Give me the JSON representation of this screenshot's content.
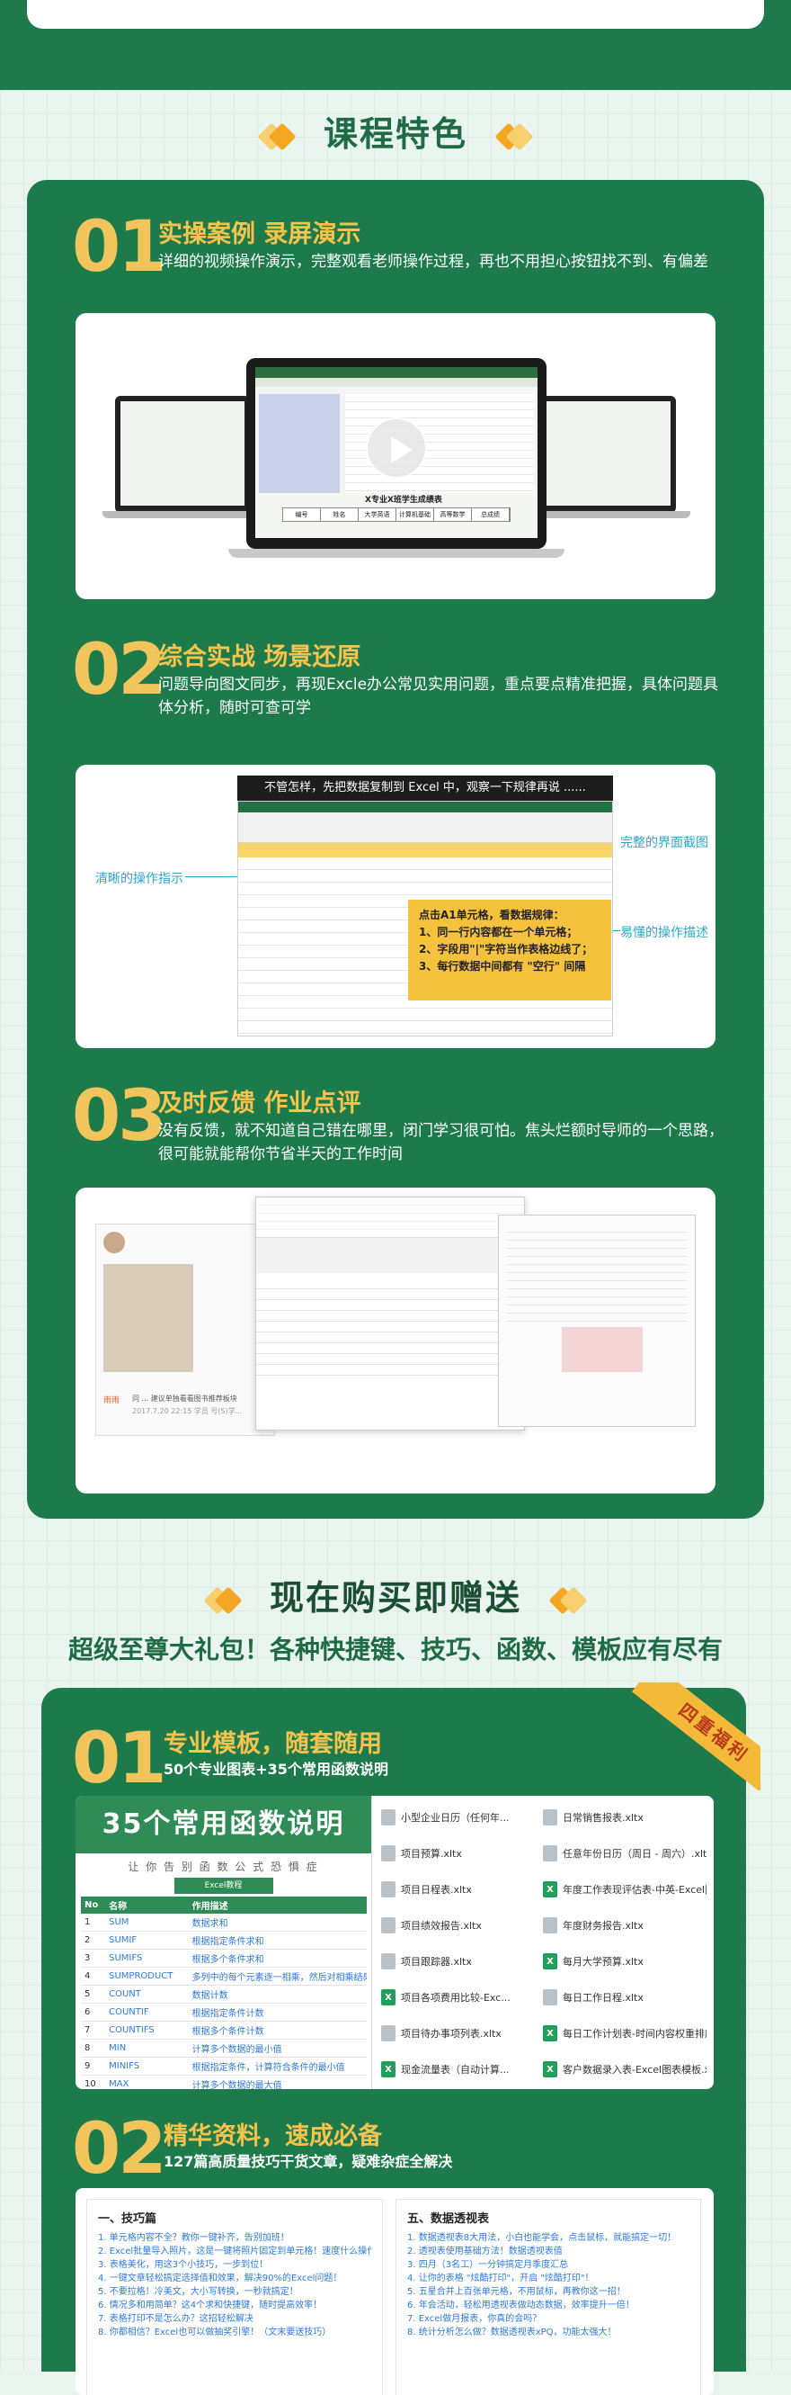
{
  "section_features": {
    "title": "课程特色",
    "items": [
      {
        "num": "01",
        "title": "实操案例  录屏演示",
        "desc": "详细的视频操作演示，完整观看老师操作过程，再也不用担心按钮找不到、有偏差"
      },
      {
        "num": "02",
        "title": "综合实战 场景还原",
        "desc": "问题导向图文同步，再现Excle办公常见实用问题，重点要点精准把握，具体问题具体分析，随时可查可学"
      },
      {
        "num": "03",
        "title": "及时反馈  作业点评",
        "desc": "没有反馈，就不知道自己错在哪里，闭门学习很可怕。焦头烂额时导师的一个思路，很可能就能帮你节省半天的工作时间"
      }
    ],
    "laptop_caption": "X专业X班学生成绩表",
    "laptop_cols": [
      "编号",
      "姓名",
      "大学英语",
      "计算机基础",
      "高等数学",
      "总成绩"
    ],
    "example_header": "不管怎样，先把数据复制到 Excel 中，观察一下规律再说 ......",
    "callout_left": "清晰的操作指示",
    "callout_right_top": "完整的界面截图",
    "callout_right_bottom": "易懂的操作描述",
    "rule_title": "点击A1单元格，看数据规律：",
    "rule_lines": [
      "1、同一行内容都在一个单元格；",
      "2、字段用\"|\"字符当作表格边线了；",
      "3、每行数据中间都有 \"空行\" 间隔"
    ],
    "feedback_name": "雨雨",
    "feedback_note": "问 ... 建议单独看看图书推荐板块",
    "feedback_time": "2017.7.20 22:15 学员 号(S)学..."
  },
  "section_gift": {
    "title": "现在购买即赠送",
    "subtitle": "超级至尊大礼包！各种快捷键、技巧、函数、模板应有尽有",
    "ribbon": "四重福利",
    "items": [
      {
        "num": "01",
        "title": "专业模板，随套随用",
        "desc": "50个专业图表+35个常用函数说明"
      },
      {
        "num": "02",
        "title": "精华资料，速成必备",
        "desc": "127篇高质量技巧干货文章，疑难杂症全解决"
      }
    ],
    "func_sheet": {
      "title": "35个常用函数说明",
      "subtitle": "让 你 告 别 函 数 公 式 恐 惧 症",
      "tag": "Excel教程",
      "headers": [
        "No",
        "名称",
        "作用描述"
      ],
      "rows": [
        [
          "1",
          "SUM",
          "数据求和"
        ],
        [
          "2",
          "SUMIF",
          "根据指定条件求和"
        ],
        [
          "3",
          "SUMIFS",
          "根据多个条件求和"
        ],
        [
          "4",
          "SUMPRODUCT",
          "多列中的每个元素逐一相乘，然后对相乘结果求和"
        ],
        [
          "5",
          "COUNT",
          "数据计数"
        ],
        [
          "6",
          "COUNTIF",
          "根据指定条件计数"
        ],
        [
          "7",
          "COUNTIFS",
          "根据多个条件计数"
        ],
        [
          "8",
          "MIN",
          "计算多个数据的最小值"
        ],
        [
          "9",
          "MINIFS",
          "根据指定条件，计算符合条件的最小值"
        ],
        [
          "10",
          "MAX",
          "计算多个数据的最大值"
        ]
      ]
    },
    "templates_left": [
      {
        "name": "小型企业日历（任何年...",
        "type": "file"
      },
      {
        "name": "项目预算.xltx",
        "type": "file"
      },
      {
        "name": "项目日程表.xltx",
        "type": "file"
      },
      {
        "name": "项目绩效报告.xltx",
        "type": "file"
      },
      {
        "name": "项目跟踪器.xltx",
        "type": "file"
      },
      {
        "name": "项目各项费用比较-Exc...",
        "type": "excel"
      },
      {
        "name": "项目待办事项列表.xltx",
        "type": "file"
      },
      {
        "name": "现金流量表（自动计算...",
        "type": "excel"
      }
    ],
    "templates_right": [
      {
        "name": "日常销售报表.xltx",
        "type": "file"
      },
      {
        "name": "任意年份日历（周日 - 周六）.xltx",
        "type": "file"
      },
      {
        "name": "年度工作表现评估表-中英-Excel图...",
        "type": "excel"
      },
      {
        "name": "年度财务报告.xltx",
        "type": "file"
      },
      {
        "name": "每月大学预算.xltx",
        "type": "excel"
      },
      {
        "name": "每日工作日程.xltx",
        "type": "file"
      },
      {
        "name": "每日工作计划表-时间内容权重排序...",
        "type": "excel"
      },
      {
        "name": "客户数据录入表-Excel图表模板.xls...",
        "type": "excel"
      }
    ],
    "article_cols": [
      {
        "heading": "一、技巧篇",
        "lines": [
          "1. 单元格内容不全？教你一键补齐，告别加班！",
          "2. Excel批量导入照片，这是一键将照片固定到单元格！速度什么操作...",
          "3. 表格美化，用这3个小技巧，一步到位！",
          "4. 一键文章轻松搞定选择值和效果，解决90%的Excel问题！",
          "5. 不要拉格！冷美文，大小写转换，一秒就搞定！",
          "6. 情况多和用简单？这4个求和快捷键，随时提高效率！",
          "7. 表格打印不是怎么办？这招轻松解决",
          "8. 你都相信？Excel也可以做抽奖引擎！（文末要送技巧）"
        ]
      },
      {
        "heading": "五、数据透视表",
        "lines": [
          "1. 数据透视表8大用法，小白也能学会，点击鼠标，就能搞定一切！",
          "2. 透视表使用基础方法！数据透视表值",
          "3. 四月（3名工）一分钟搞定月季度汇总",
          "4. 让你的表格 \"炫酷打印\"，开启 \"炫酷打印\"！",
          "5. 五星合并上百张单元格，不用鼠标，再教你这一招！",
          "6. 年会活动，轻松用透视表做动态数据，效率提升一倍！",
          "7. Excel做月报表，你真的会吗？",
          "8. 统计分析怎么做？数据透视表xPQ，功能太强大！"
        ]
      }
    ]
  }
}
